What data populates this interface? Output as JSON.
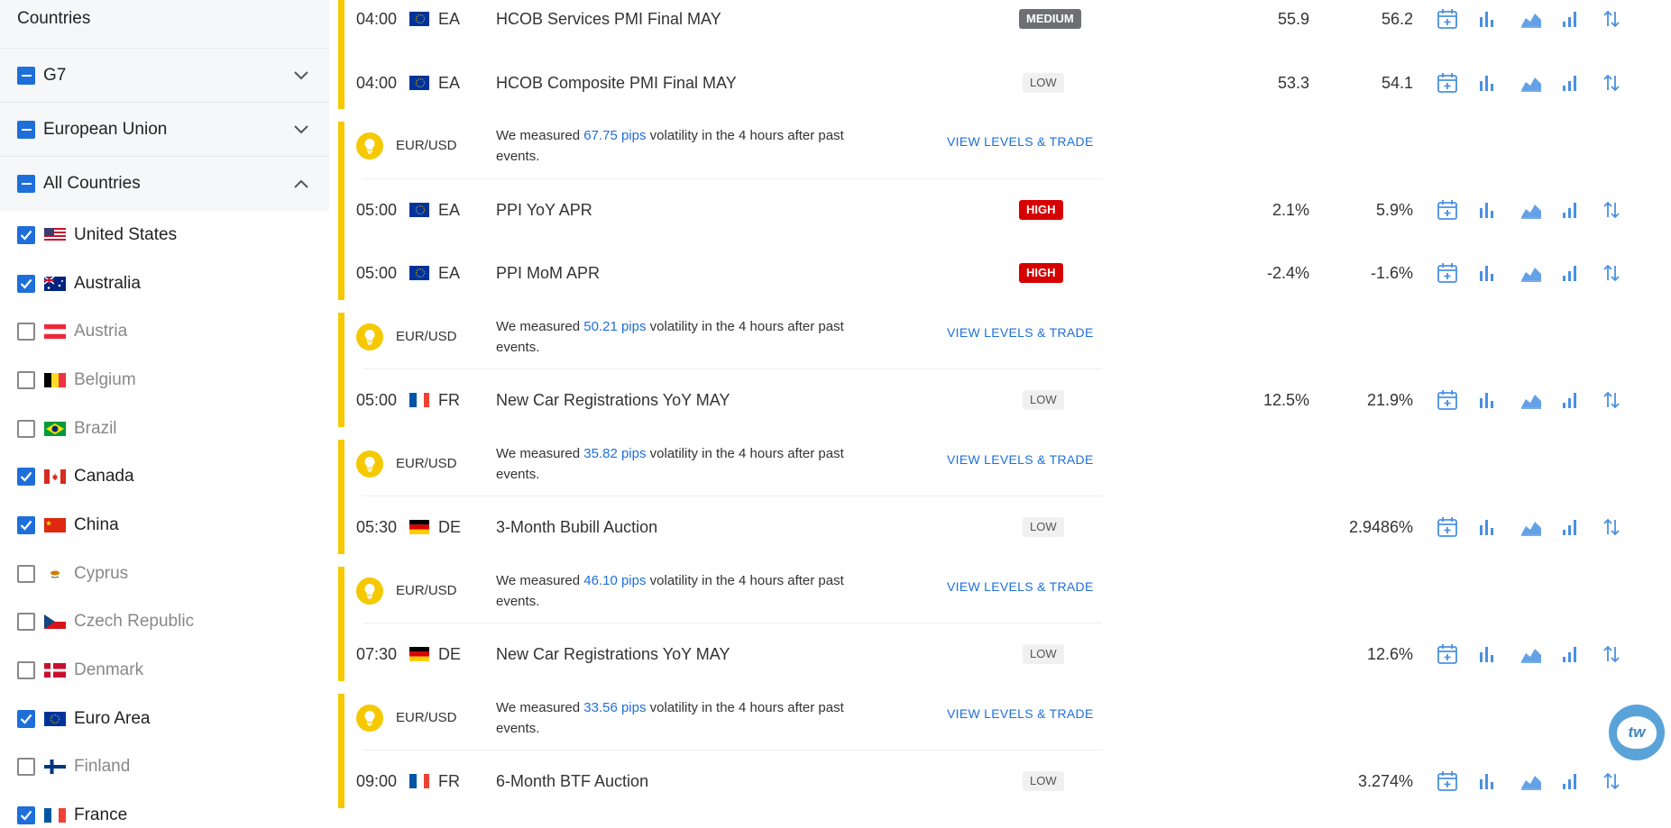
{
  "sidebar": {
    "title": "Countries",
    "groups": [
      {
        "label": "G7"
      },
      {
        "label": "European Union"
      },
      {
        "label": "All Countries"
      }
    ],
    "countries": [
      {
        "name": "United States",
        "checked": true
      },
      {
        "name": "Australia",
        "checked": true
      },
      {
        "name": "Austria",
        "checked": false
      },
      {
        "name": "Belgium",
        "checked": false
      },
      {
        "name": "Brazil",
        "checked": false
      },
      {
        "name": "Canada",
        "checked": true
      },
      {
        "name": "China",
        "checked": true
      },
      {
        "name": "Cyprus",
        "checked": false
      },
      {
        "name": "Czech Republic",
        "checked": false
      },
      {
        "name": "Denmark",
        "checked": false
      },
      {
        "name": "Euro Area",
        "checked": true
      },
      {
        "name": "Finland",
        "checked": false
      },
      {
        "name": "France",
        "checked": true
      }
    ]
  },
  "events": [
    {
      "time": "04:00",
      "code": "EA",
      "title": "HCOB Services PMI Final MAY",
      "importance": "MEDIUM",
      "actual": "55.9",
      "previous": "56.2"
    },
    {
      "time": "04:00",
      "code": "EA",
      "title": "HCOB Composite PMI Final MAY",
      "importance": "LOW",
      "actual": "53.3",
      "previous": "54.1"
    },
    {
      "time": "05:00",
      "code": "EA",
      "title": "PPI YoY APR",
      "importance": "HIGH",
      "actual": "2.1%",
      "previous": "5.9%"
    },
    {
      "time": "05:00",
      "code": "EA",
      "title": "PPI MoM APR",
      "importance": "HIGH",
      "actual": "-2.4%",
      "previous": "-1.6%"
    },
    {
      "time": "05:00",
      "code": "FR",
      "title": "New Car Registrations YoY MAY",
      "importance": "LOW",
      "actual": "12.5%",
      "previous": "21.9%"
    },
    {
      "time": "05:30",
      "code": "DE",
      "title": "3-Month Bubill Auction",
      "importance": "LOW",
      "actual": "",
      "previous": "2.9486%"
    },
    {
      "time": "07:30",
      "code": "DE",
      "title": "New Car Registrations YoY MAY",
      "importance": "LOW",
      "actual": "",
      "previous": "12.6%"
    },
    {
      "time": "09:00",
      "code": "FR",
      "title": "6-Month BTF Auction",
      "importance": "LOW",
      "actual": "",
      "previous": "3.274%"
    }
  ],
  "volatility": [
    {
      "pair": "EUR/USD",
      "prefix": "We measured ",
      "pips": "67.75 pips",
      "suffix": " volatility in the 4 hours after past events.",
      "link": "VIEW LEVELS & TRADE"
    },
    {
      "pair": "EUR/USD",
      "prefix": "We measured ",
      "pips": "50.21 pips",
      "suffix": " volatility in the 4 hours after past events.",
      "link": "VIEW LEVELS & TRADE"
    },
    {
      "pair": "EUR/USD",
      "prefix": "We measured ",
      "pips": "35.82 pips",
      "suffix": " volatility in the 4 hours after past events.",
      "link": "VIEW LEVELS & TRADE"
    },
    {
      "pair": "EUR/USD",
      "prefix": "We measured ",
      "pips": "46.10 pips",
      "suffix": " volatility in the 4 hours after past events.",
      "link": "VIEW LEVELS & TRADE"
    },
    {
      "pair": "EUR/USD",
      "prefix": "We measured ",
      "pips": "33.56 pips",
      "suffix": " volatility in the 4 hours after past events.",
      "link": "VIEW LEVELS & TRADE"
    }
  ],
  "chat": {
    "label": "tw"
  },
  "colors": {
    "accent": "#1e6fd9",
    "highlight": "#f5c800",
    "high": "#d60000",
    "medium": "#6d6f73"
  }
}
